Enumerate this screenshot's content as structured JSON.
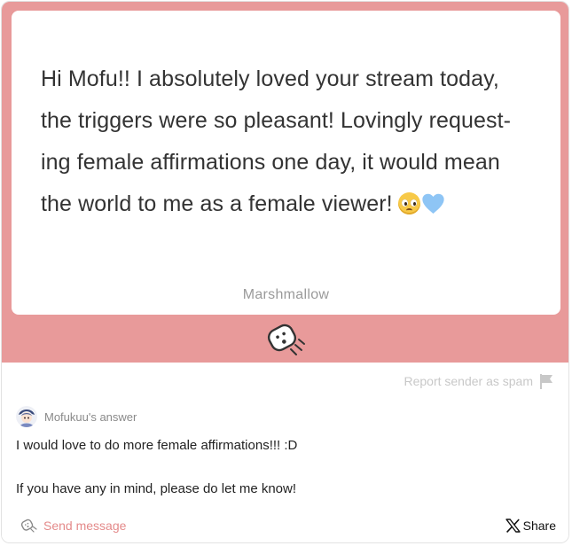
{
  "message": {
    "text": "Hi Mofu!! I absolutely loved your stream today, the triggers were so pleasant! Lovingly request-ing female affirmations one day, it would mean the world to me as a female viewer!",
    "lines": [
      "Hi Mofu!! I absolutely loved your stream today,",
      "the triggers were so pleasant! Lovingly request-",
      "ing female affirmations one day, it would mean",
      "the world to me as a female viewer!"
    ],
    "emoji": [
      "pleading-face-emoji",
      "blue-heart-emoji"
    ],
    "footer": "Marshmallow"
  },
  "actions": {
    "report_label": "Report sender as spam",
    "send_message_label": "Send message",
    "share_label": "Share"
  },
  "answer": {
    "header": "Mofukuu's answer",
    "paragraphs": [
      "I would love to do more female affirmations!!! :D",
      "If you have any in mind, please do let me know!"
    ]
  },
  "icons": {
    "marshmallow": "marshmallow-logo-icon",
    "report": "flag-icon",
    "send": "marshmallow-send-icon",
    "share": "x-logo-icon"
  },
  "colors": {
    "panel": "#e89a9a",
    "accent_text": "#e48a8a",
    "muted_text": "#9a9a9a",
    "heart": "#8ec5f5"
  }
}
